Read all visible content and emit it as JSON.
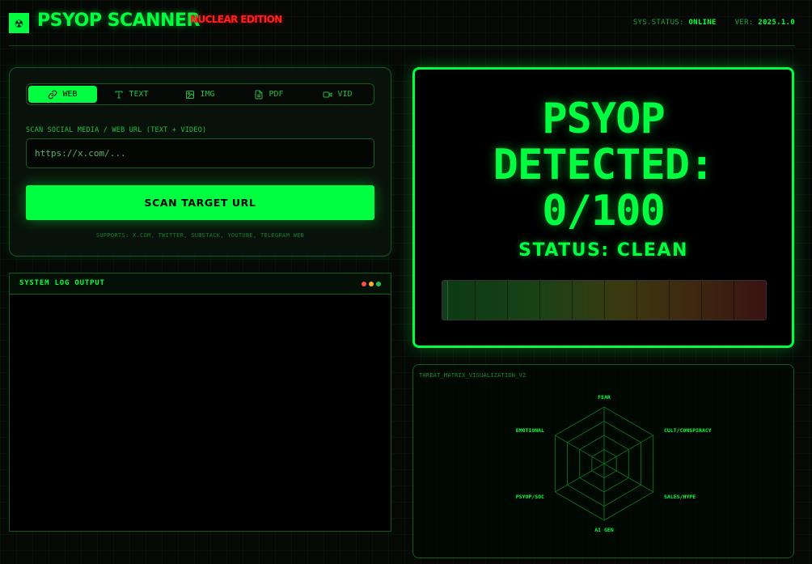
{
  "header": {
    "logo_glyph": "☢",
    "app_title": "PSYOP SCANNER",
    "edition": "NUCLEAR EDITION",
    "status_label": "SYS.STATUS:",
    "status_value": "ONLINE",
    "version_label": "VER:",
    "version_value": "2025.1.0"
  },
  "input_panel": {
    "tabs": [
      {
        "label": "WEB",
        "icon": "link-icon",
        "active": true
      },
      {
        "label": "TEXT",
        "icon": "text-icon",
        "active": false
      },
      {
        "label": "IMG",
        "icon": "image-icon",
        "active": false
      },
      {
        "label": "PDF",
        "icon": "file-icon",
        "active": false
      },
      {
        "label": "VID",
        "icon": "video-icon",
        "active": false
      }
    ],
    "url_label": "SCAN SOCIAL MEDIA / WEB URL (TEXT + VIDEO)",
    "url_placeholder": "https://x.com/...",
    "url_value": "",
    "scan_button": "SCAN TARGET URL",
    "supports": "SUPPORTS: X.COM, TWITTER, SUBSTACK, YOUTUBE, TELEGRAM WEB"
  },
  "log_panel": {
    "title": "SYSTEM LOG OUTPUT",
    "dot_colors": [
      "#ff4d4d",
      "#ffb020",
      "#1ec24a"
    ]
  },
  "result_panel": {
    "line1": "PSYOP",
    "line2": "DETECTED:",
    "score": "0/100",
    "status": "STATUS: CLEAN",
    "score_fraction": 0.0,
    "meter_segments": 10
  },
  "radar_panel": {
    "title": "THREAT_MATRIX_VISUALIZATION_V2",
    "axes": [
      "FEAR",
      "CULT/CONSPIRACY",
      "SALES/HYPE",
      "AI GEN",
      "PSYOP/SOC",
      "EMOTIONAL"
    ],
    "values": [
      0,
      0,
      0,
      0,
      0,
      0
    ],
    "rings": 4
  },
  "colors": {
    "accent": "#00ff41",
    "danger": "#ff2020",
    "background": "#060806"
  }
}
